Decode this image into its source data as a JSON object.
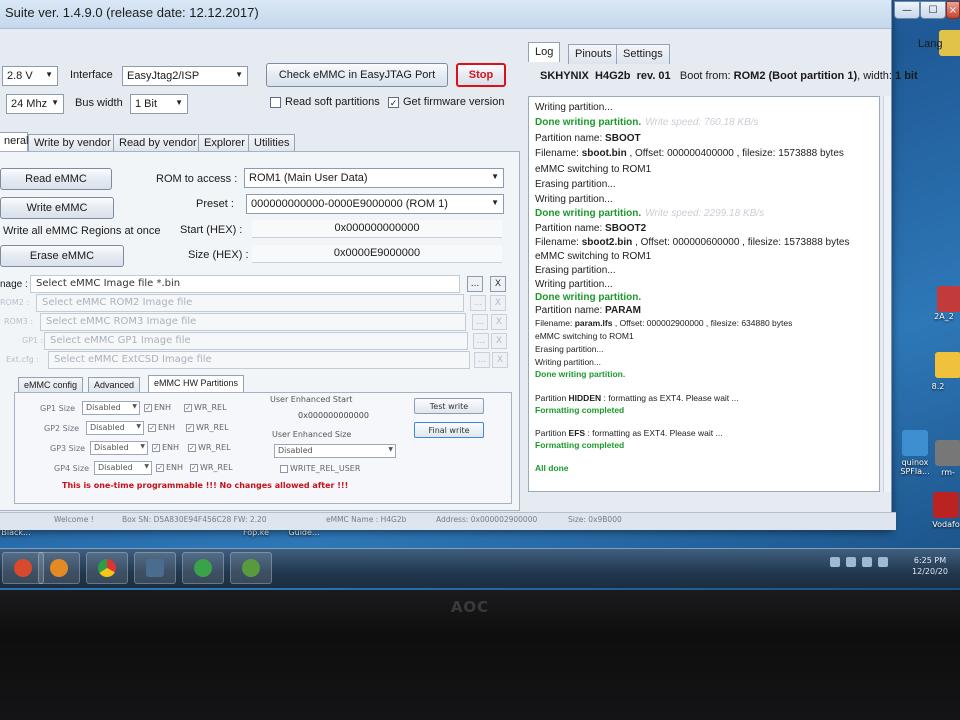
{
  "window": {
    "title": "Suite  ver. 1.4.9.0 (release date: 12.12.2017)",
    "controls": {
      "minimize": "—",
      "maximize": "☐"
    }
  },
  "toolbar": {
    "voltage_value": "2.8 V",
    "interface_label": "Interface",
    "interface_value": "EasyJtag2/ISP",
    "frequency_value": "24 Mhz",
    "bus_width_label": "Bus width",
    "bus_width_value": "1 Bit",
    "check_emmc_button": "Check eMMC in EasyJTAG Port",
    "stop_button": "Stop",
    "read_soft_partitions": "Read soft partitions",
    "read_soft_partitions_checked": false,
    "get_firmware_version": "Get firmware version",
    "get_firmware_version_checked": true
  },
  "left_tabs": [
    "neral",
    "Write by vendor",
    "Read by vendor",
    "Explorer",
    "Utilities"
  ],
  "actions": {
    "read_emmc": "Read eMMC",
    "write_emmc": "Write eMMC",
    "write_all": "Write all eMMC Regions at once",
    "erase_emmc": "Erase eMMC"
  },
  "fields": {
    "rom_label": "ROM to access :",
    "rom_value": "ROM1 (Main User Data)",
    "preset_label": "Preset :",
    "preset_value": "000000000000-0000E9000000 (ROM 1)",
    "start_label": "Start (HEX) :",
    "start_value": "0x000000000000",
    "size_label": "Size (HEX) :",
    "size_value": "0x0000E9000000"
  },
  "image_rows": [
    {
      "label": "nage :",
      "placeholder": "Select eMMC Image file *.bin",
      "enabled": true
    },
    {
      "label": "ROM2 :",
      "placeholder": "Select eMMC ROM2 Image file",
      "enabled": false
    },
    {
      "label": "ROM3 :",
      "placeholder": "Select eMMC ROM3 Image file",
      "enabled": false
    },
    {
      "label": "GP1 :",
      "placeholder": "Select eMMC GP1 Image file",
      "enabled": false
    },
    {
      "label": "Ext.cfg :",
      "placeholder": "Select eMMC ExtCSD Image file",
      "enabled": false
    }
  ],
  "browse_glyph": "...",
  "clear_glyph": "X",
  "sub_tabs": [
    "eMMC config",
    "Advanced",
    "eMMC HW Partitions"
  ],
  "hw_partitions": {
    "rows": [
      {
        "label": "GP1 Size",
        "value": "Disabled"
      },
      {
        "label": "GP2 Size",
        "value": "Disabled"
      },
      {
        "label": "GP3 Size",
        "value": "Disabled"
      },
      {
        "label": "GP4 Size",
        "value": "Disabled"
      }
    ],
    "enh_label": "ENH",
    "wr_rel_label": "WR_REL",
    "user_enhanced_start_label": "User Enhanced Start",
    "user_enhanced_start_value": "0x000000000000",
    "user_enhanced_size_label": "User Enhanced Size",
    "user_enhanced_size_value": "Disabled",
    "write_rel_user": "WRITE_REL_USER",
    "test_write": "Test write",
    "final_write": "Final write",
    "warning": "This is one-time programmable !!! No changes allowed after !!!"
  },
  "right_tabs": [
    "Log",
    "Pinouts",
    "Settings"
  ],
  "lang_label": "Lang",
  "device_info": {
    "vendor": "SKHYNIX",
    "model": "H4G2b",
    "rev": "rev. 01",
    "boot_label": "Boot from:",
    "boot_value": "ROM2 (Boot partition 1)",
    "width_label": ", width:",
    "width_value": "1 bit"
  },
  "log": {
    "l01": "Writing partition...",
    "l02": "Done writing partition.",
    "l02s": "Write speed: 760.18 KB/s",
    "l03a": "Partition name: ",
    "l03b": "SBOOT",
    "l04a": "Filename: ",
    "l04b": "sboot.bin",
    "l04c": " , Offset: 000000400000 , filesize: 1573888 bytes",
    "l05": "eMMC switching to ROM1",
    "l06": "Erasing partition...",
    "l07": "Writing partition...",
    "l08": "Done writing partition.",
    "l08s": "Write speed: 2299.18 KB/s",
    "l09a": "Partition name: ",
    "l09b": "SBOOT2",
    "l10a": "Filename: ",
    "l10b": "sboot2.bin",
    "l10c": " , Offset: 000000600000 , filesize: 1573888 bytes",
    "l11": "eMMC switching to ROM1",
    "l12": "Erasing partition...",
    "l13": "Writing partition...",
    "l14": "Done writing partition.",
    "l15a": "Partition name: ",
    "l15b": "PARAM",
    "l16a": "Filename: ",
    "l16b": "param.lfs",
    "l16c": " , Offset: 000002900000 , filesize: 634880 bytes",
    "l17": "eMMC switching to ROM1",
    "l18": "Erasing partition...",
    "l19": "Writing partition...",
    "l20": "Done writing partition.",
    "l21a": "Partition ",
    "l21b": "HIDDEN",
    "l21c": " : formatting as EXT4. Please wait ...",
    "l22": "Formatting completed",
    "l23a": "Partition ",
    "l23b": "EFS",
    "l23c": " : formatting as EXT4. Please wait ...",
    "l24": "Formatting completed",
    "l25": "All done"
  },
  "status": {
    "welcome": "Welcome !",
    "box_sn": "Box SN: D5A830E94F456C28  FW: 2.20",
    "emmc_name": "eMMC Name : H4G2b",
    "address": "Address: 0x000002900000",
    "size": "Size: 0x9B000"
  },
  "desktop": {
    "clock": "6:25 PM",
    "date": "12/20/20",
    "icon_labels": [
      "Black...",
      "2A_2",
      "8.2",
      "quinox SPFla...",
      "rm-",
      "Vodafo",
      "Fop.ke",
      "Guide..."
    ]
  },
  "monitor_brand": "AOC",
  "colors": {
    "ok_green": "#1b9a2c",
    "stop_red": "#d8111b",
    "warning_red": "#c8111b"
  }
}
